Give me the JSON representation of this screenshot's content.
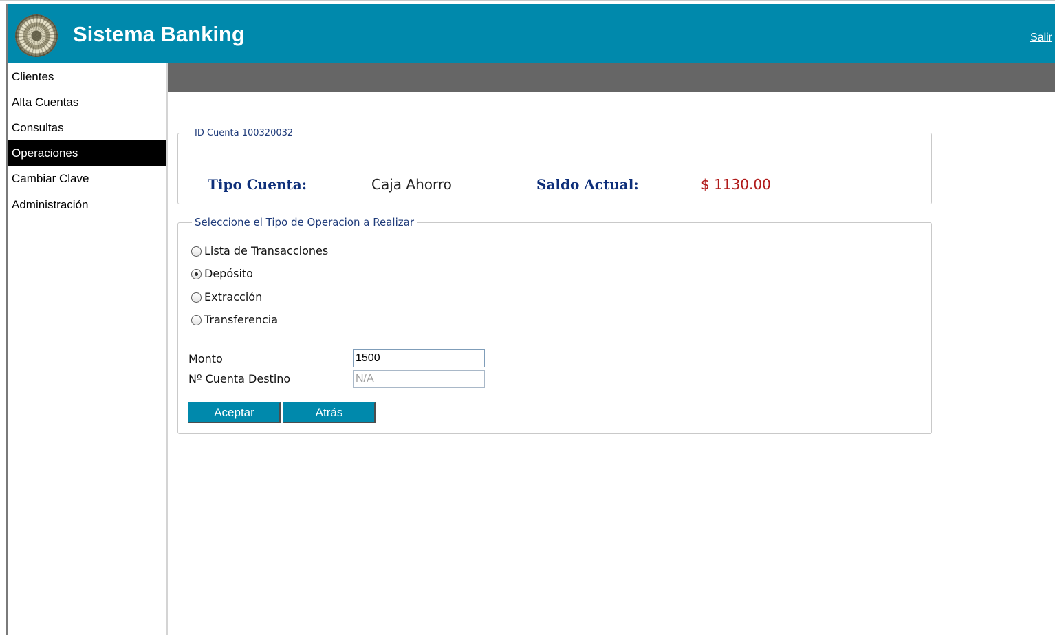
{
  "header": {
    "app_title": "Sistema Banking",
    "logout_label": "Salir",
    "accent_color": "#0089ac"
  },
  "sidebar": {
    "items": [
      {
        "label": "Clientes",
        "active": false
      },
      {
        "label": "Alta Cuentas",
        "active": false
      },
      {
        "label": "Consultas",
        "active": false
      },
      {
        "label": "Operaciones",
        "active": true
      },
      {
        "label": "Cambiar Clave",
        "active": false
      },
      {
        "label": "Administración",
        "active": false
      }
    ]
  },
  "account": {
    "legend": "ID Cuenta 100320032",
    "type_label": "Tipo Cuenta:",
    "type_value": "Caja Ahorro",
    "balance_label": "Saldo Actual:",
    "balance_value": "$ 1130.00",
    "balance_color": "#b01a1a"
  },
  "operations": {
    "legend": "Seleccione el Tipo de Operacion a Realizar",
    "options": [
      {
        "label": "Lista de Transacciones",
        "checked": false
      },
      {
        "label": "Depósito",
        "checked": true
      },
      {
        "label": "Extracción",
        "checked": false
      },
      {
        "label": "Transferencia",
        "checked": false
      }
    ],
    "amount_label": "Monto",
    "amount_value": "1500",
    "dest_label": "Nº Cuenta Destino",
    "dest_value": "N/A",
    "accept_label": "Aceptar",
    "back_label": "Atrás"
  }
}
